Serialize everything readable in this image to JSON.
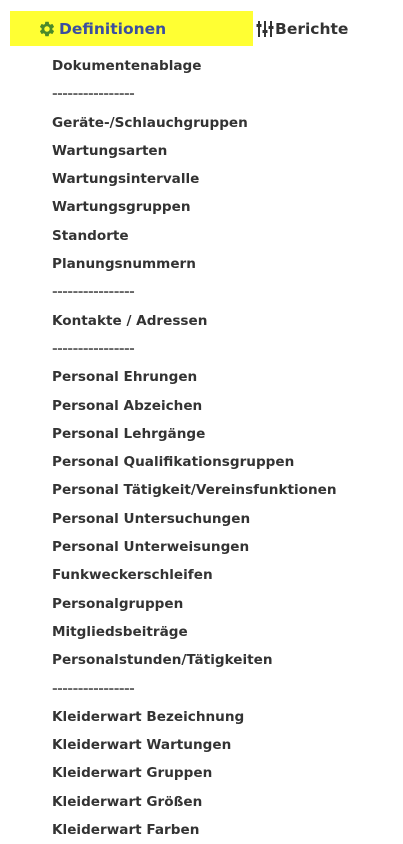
{
  "colors": {
    "highlight": "#ffff33",
    "active_tab_text": "#3b4ea0",
    "gear_icon": "#4a8a2a",
    "menu_text": "#333333"
  },
  "tabs": {
    "definitions": {
      "label": "Definitionen",
      "icon": "gear-icon"
    },
    "reports": {
      "label": "Berichte",
      "icon": "sliders-icon"
    }
  },
  "menu": {
    "items": [
      {
        "label": "Dokumentenablage",
        "type": "link"
      },
      {
        "label": "----------------",
        "type": "separator"
      },
      {
        "label": "Geräte-/Schlauchgruppen",
        "type": "link"
      },
      {
        "label": "Wartungsarten",
        "type": "link"
      },
      {
        "label": "Wartungsintervalle",
        "type": "link"
      },
      {
        "label": "Wartungsgruppen",
        "type": "link"
      },
      {
        "label": "Standorte",
        "type": "link"
      },
      {
        "label": "Planungsnummern",
        "type": "link"
      },
      {
        "label": "----------------",
        "type": "separator"
      },
      {
        "label": "Kontakte / Adressen",
        "type": "link"
      },
      {
        "label": "----------------",
        "type": "separator"
      },
      {
        "label": "Personal Ehrungen",
        "type": "link"
      },
      {
        "label": "Personal Abzeichen",
        "type": "link"
      },
      {
        "label": "Personal Lehrgänge",
        "type": "link"
      },
      {
        "label": "Personal Qualifikationsgruppen",
        "type": "link"
      },
      {
        "label": "Personal Tätigkeit/Vereinsfunktionen",
        "type": "link"
      },
      {
        "label": "Personal Untersuchungen",
        "type": "link"
      },
      {
        "label": "Personal Unterweisungen",
        "type": "link"
      },
      {
        "label": "Funkweckerschleifen",
        "type": "link"
      },
      {
        "label": "Personalgruppen",
        "type": "link"
      },
      {
        "label": "Mitgliedsbeiträge",
        "type": "link"
      },
      {
        "label": "Personalstunden/Tätigkeiten",
        "type": "link"
      },
      {
        "label": "----------------",
        "type": "separator"
      },
      {
        "label": "Kleiderwart Bezeichnung",
        "type": "link"
      },
      {
        "label": "Kleiderwart Wartungen",
        "type": "link"
      },
      {
        "label": "Kleiderwart Gruppen",
        "type": "link"
      },
      {
        "label": "Kleiderwart Größen",
        "type": "link",
        "active": true
      },
      {
        "label": "Kleiderwart Farben",
        "type": "link"
      }
    ]
  }
}
